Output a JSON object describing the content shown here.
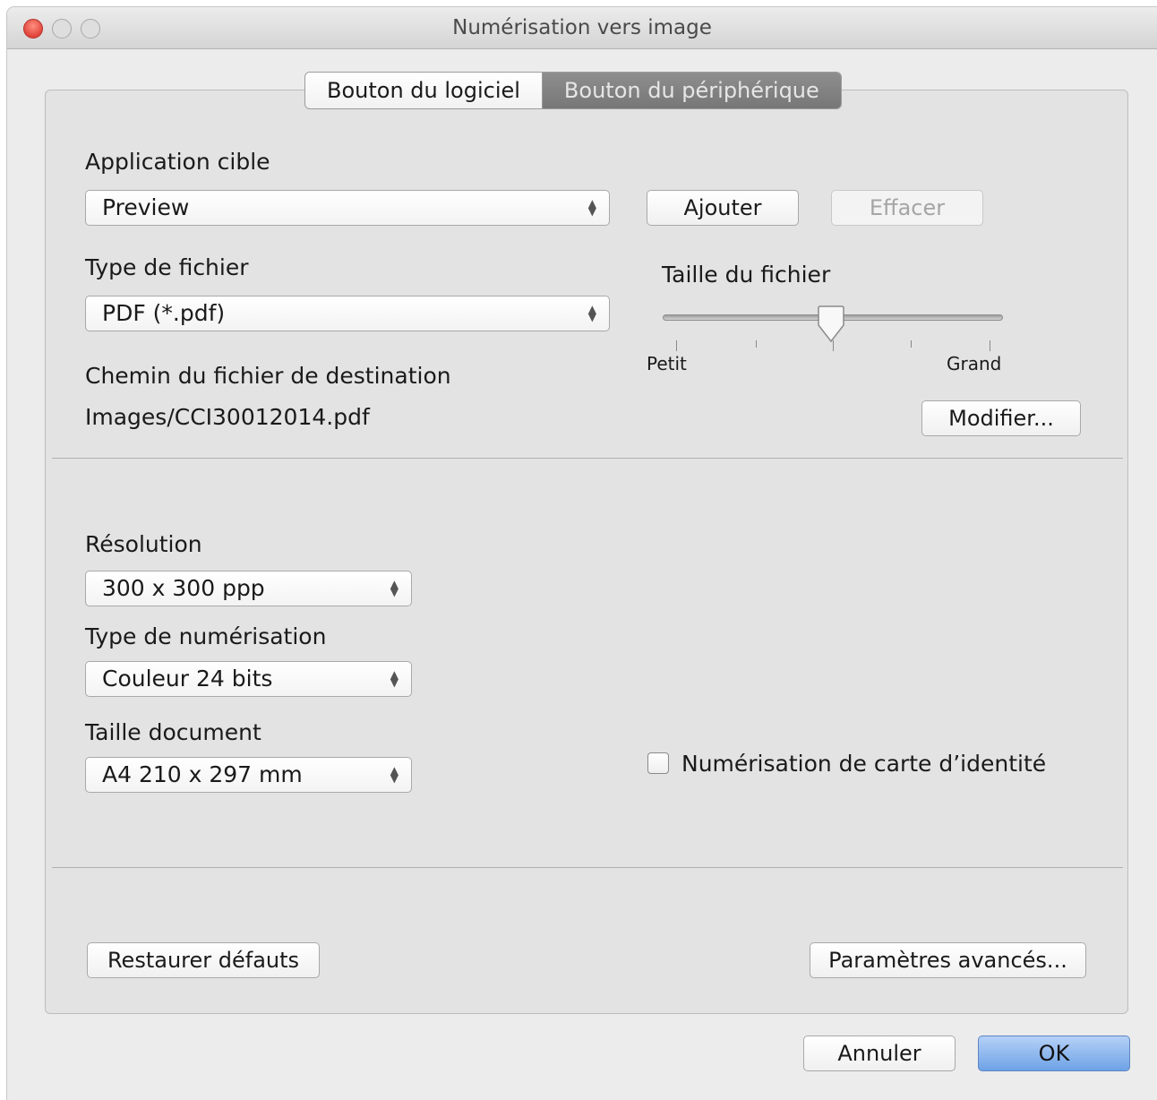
{
  "window": {
    "title": "Numérisation vers image"
  },
  "tabs": [
    {
      "label": "Bouton du logiciel"
    },
    {
      "label": "Bouton du périphérique"
    }
  ],
  "app": {
    "label": "Application cible",
    "value": "Preview",
    "add_label": "Ajouter",
    "delete_label": "Effacer"
  },
  "file_type": {
    "label": "Type de fichier",
    "value": "PDF (*.pdf)"
  },
  "file_size": {
    "label": "Taille du fichier",
    "min_label": "Petit",
    "max_label": "Grand",
    "level": 0.5
  },
  "destination": {
    "label": "Chemin du fichier de destination",
    "value": "Images/CCI30012014.pdf",
    "modify_label": "Modifier..."
  },
  "resolution": {
    "label": "Résolution",
    "value": "300 x 300 ppp"
  },
  "scan_type": {
    "label": "Type de numérisation",
    "value": "Couleur 24 bits"
  },
  "doc_size": {
    "label": "Taille document",
    "value": "A4 210 x 297 mm"
  },
  "id_card": {
    "label": "Numérisation de carte d’identité",
    "checked": false
  },
  "buttons": {
    "restore": "Restaurer défauts",
    "advanced": "Paramètres avancés...",
    "cancel": "Annuler",
    "ok": "OK"
  }
}
